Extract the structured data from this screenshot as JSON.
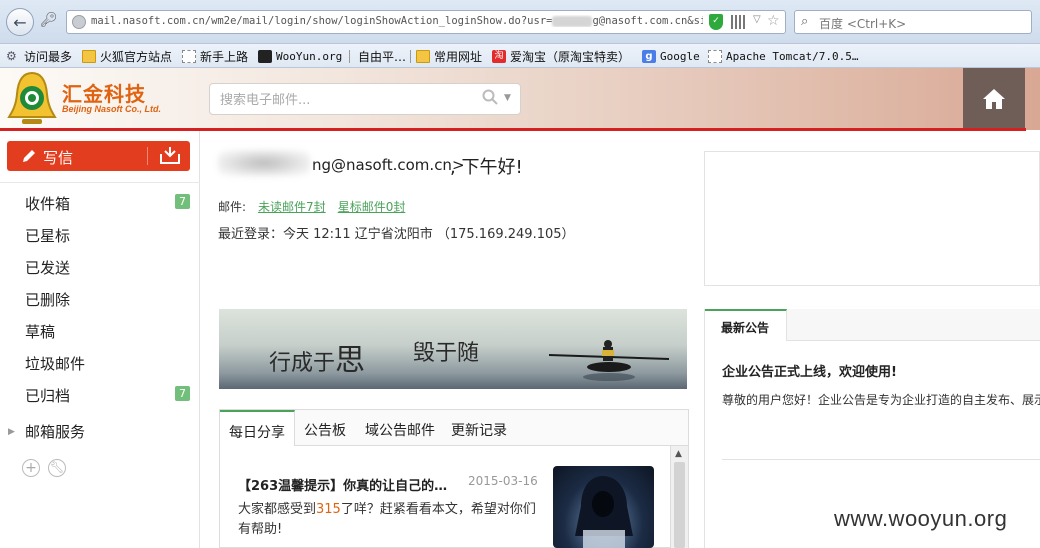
{
  "browser": {
    "url_prefix": "mail.nasoft.com.cn/wm2e/mail/login/show/loginShowAction_loginShow.do?usr=",
    "url_suffix": "g@nasoft.com.cn&sid=MH",
    "search_placeholder": "百度 <Ctrl+K>",
    "bookmarks": [
      {
        "label": "访问最多",
        "icon": "gear-icon"
      },
      {
        "label": "火狐官方站点",
        "icon": "folder-icon"
      },
      {
        "label": "新手上路",
        "icon": "page-icon"
      },
      {
        "label": "WooYun.org",
        "icon": "wooyun-icon"
      },
      {
        "label": "自由平…",
        "icon": "none"
      },
      {
        "label": "常用网址",
        "icon": "folder-icon"
      },
      {
        "label": "爱淘宝（原淘宝特卖）",
        "icon": "taobao-icon"
      },
      {
        "label": "Google",
        "icon": "google-icon"
      },
      {
        "label": "Apache Tomcat/7.0.5…",
        "icon": "page-icon"
      }
    ]
  },
  "header": {
    "logo_title": "汇金科技",
    "logo_subtitle": "Beijing Nasoft Co., Ltd.",
    "search_placeholder": "搜索电子邮件...",
    "brand_color": "#e06312",
    "accent_red": "#d42020"
  },
  "sidebar": {
    "compose_label": "写信",
    "items": [
      {
        "label": "收件箱",
        "badge": "7"
      },
      {
        "label": "已星标",
        "badge": ""
      },
      {
        "label": "已发送",
        "badge": ""
      },
      {
        "label": "已删除",
        "badge": ""
      },
      {
        "label": "草稿",
        "badge": ""
      },
      {
        "label": "垃圾邮件",
        "badge": ""
      },
      {
        "label": "已归档",
        "badge": "7"
      },
      {
        "label": "邮箱服务",
        "badge": ""
      }
    ]
  },
  "main": {
    "greeting_email": "ng@nasoft.com.cn>",
    "greeting_hello": ", 下午好!",
    "mail_label": "邮件:",
    "unread_link": "未读邮件7封",
    "starred_link": "星标邮件0封",
    "last_login": "最近登录：今天 12:11 辽宁省沈阳市 （175.169.249.105）",
    "banner_part1": "行成于",
    "banner_big": "思",
    "banner_part2": "毁于随",
    "tabs": [
      "每日分享",
      "公告板",
      "域公告邮件",
      "更新记录"
    ],
    "share": {
      "title": "【263温馨提示】你真的让自己的…",
      "date": "2015-03-16",
      "body_before": "大家都感受到",
      "body_num": "315",
      "body_after": "了咩？赶紧看看本文，希望对你们有帮助!"
    }
  },
  "notice": {
    "tab": "最新公告",
    "title": "企业公告正式上线，欢迎使用!",
    "text": "尊敬的用户您好！企业公告是专为企业打造的自主发布、展示"
  },
  "watermark": "www.wooyun.org"
}
